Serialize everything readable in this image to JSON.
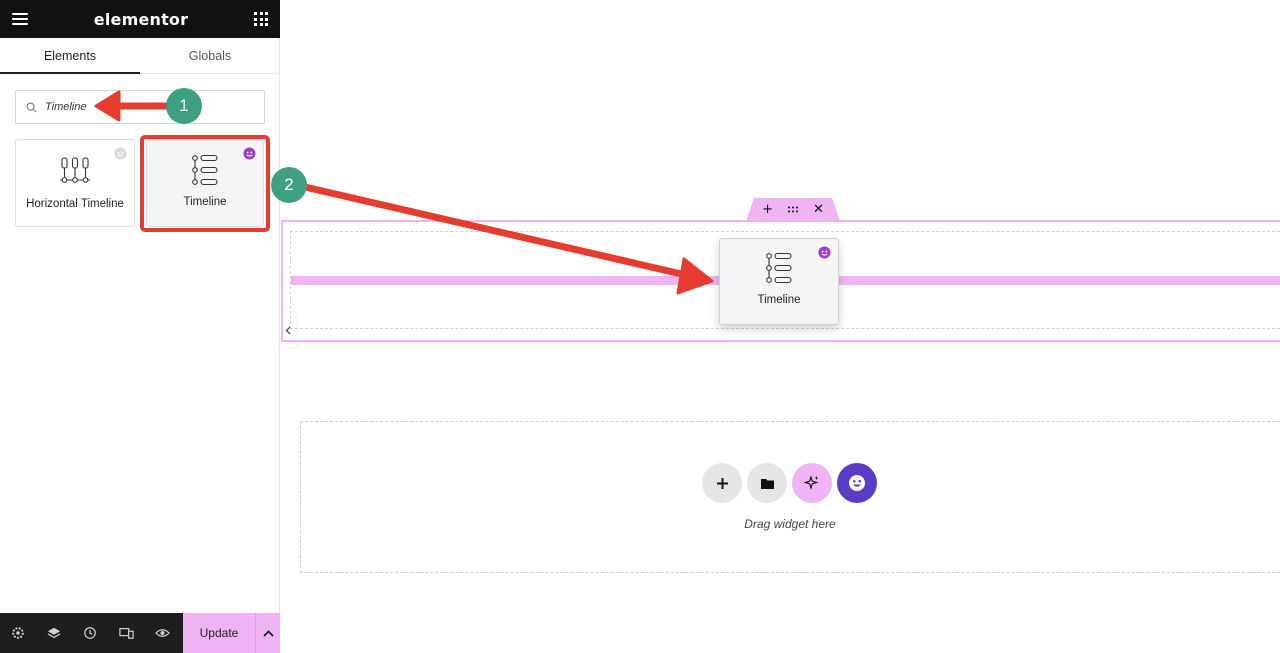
{
  "app": {
    "brand": "elementor"
  },
  "tabs": [
    {
      "label": "Elements",
      "active": true
    },
    {
      "label": "Globals",
      "active": false
    }
  ],
  "search": {
    "value": "Timeline",
    "icon": "search-icon"
  },
  "widgets": [
    {
      "label": "Horizontal Timeline",
      "icon": "horizontal-timeline-icon",
      "badge": "pro-badge-inactive"
    },
    {
      "label": "Timeline",
      "icon": "timeline-icon",
      "badge": "pro-badge-active"
    }
  ],
  "bottom_bar": {
    "icons": [
      "settings-icon",
      "layers-icon",
      "history-icon",
      "responsive-icon",
      "preview-icon"
    ],
    "update_label": "Update"
  },
  "canvas": {
    "drag_ghost_label": "Timeline",
    "section_handle": [
      "add-icon",
      "drag-icon",
      "close-icon"
    ],
    "drop_zone_text": "Drag widget here"
  },
  "callouts": [
    {
      "label": "1"
    },
    {
      "label": "2"
    }
  ],
  "colors": {
    "topbar": "#111111",
    "accent_pink": "#f0b4f4",
    "highlight_red": "#e43d2f",
    "callout_green": "#3f9f82",
    "pro_purple": "#5b3cc4"
  }
}
